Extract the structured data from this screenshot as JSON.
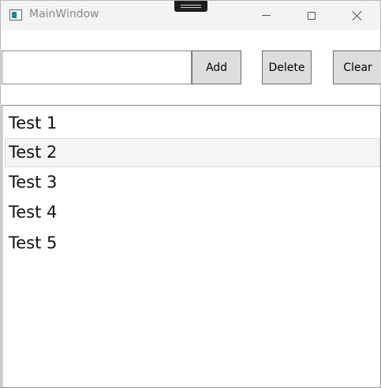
{
  "window": {
    "title": "MainWindow"
  },
  "toolbar": {
    "input_value": "",
    "add_label": "Add",
    "delete_label": "Delete",
    "clear_label": "Clear"
  },
  "list": {
    "items": [
      "Test 1",
      "Test 2",
      "Test 3",
      "Test 4",
      "Test 5"
    ],
    "selected_index": 1
  }
}
